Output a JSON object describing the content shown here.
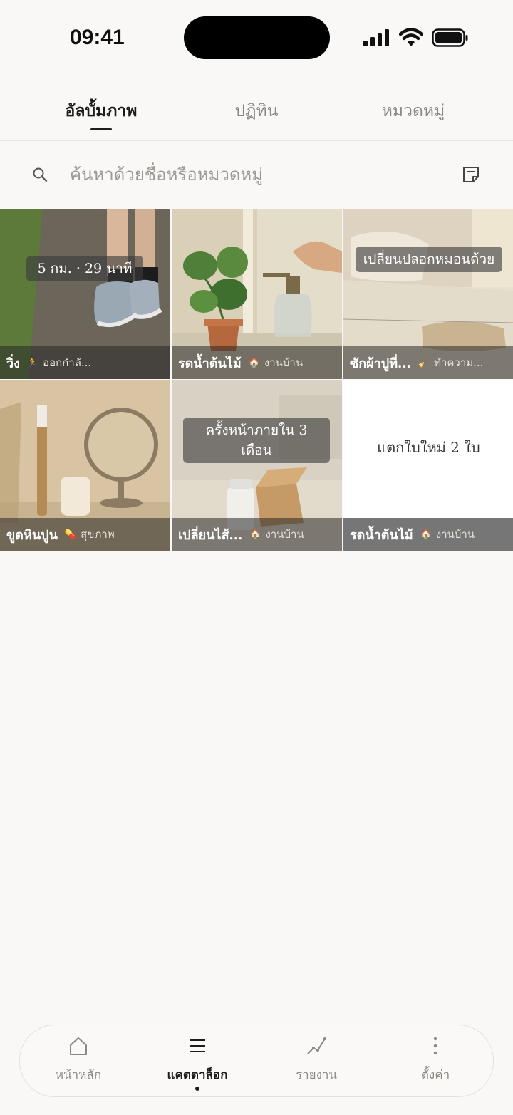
{
  "status_bar": {
    "time": "09:41"
  },
  "tabs": [
    {
      "label": "อัลบั้มภาพ",
      "active": true
    },
    {
      "label": "ปฏิทิน",
      "active": false
    },
    {
      "label": "หมวดหมู่",
      "active": false
    }
  ],
  "search": {
    "placeholder": "ค้นหาด้วยชื่อหรือหมวดหมู่",
    "value": ""
  },
  "tiles": [
    {
      "title": "วิ่ง",
      "category": "ออกกำลั...",
      "category_icon": "running-icon",
      "overlay": "5 กม. · 29 นาที"
    },
    {
      "title": "รดน้ำต้นไม้",
      "category": "งานบ้าน",
      "category_icon": "house-icon",
      "overlay": ""
    },
    {
      "title": "ซักผ้าปูที่...",
      "category": "ทำความ...",
      "category_icon": "broom-icon",
      "overlay": "เปลี่ยนปลอกหมอนด้วย"
    },
    {
      "title": "ขูดหินปูน",
      "category": "สุขภาพ",
      "category_icon": "pill-icon",
      "overlay": ""
    },
    {
      "title": "เปลี่ยนไส้...",
      "category": "งานบ้าน",
      "category_icon": "house-icon",
      "overlay": "ครั้งหน้าภายใน 3 เดือน"
    },
    {
      "title": "รดน้ำต้นไม้",
      "category": "งานบ้าน",
      "category_icon": "house-icon",
      "overlay": "",
      "note": "แตกใบใหม่ 2 ใบ"
    }
  ],
  "bottom_nav": [
    {
      "label": "หน้าหลัก",
      "icon": "home-icon",
      "active": false
    },
    {
      "label": "แคตตาล็อก",
      "icon": "menu-icon",
      "active": true
    },
    {
      "label": "รายงาน",
      "icon": "chart-line-icon",
      "active": false
    },
    {
      "label": "ตั้งค่า",
      "icon": "more-vertical-icon",
      "active": false
    }
  ],
  "colors": {
    "background": "#f9f8f6",
    "text_primary": "#1d1c1a",
    "text_muted": "#8b8884"
  }
}
